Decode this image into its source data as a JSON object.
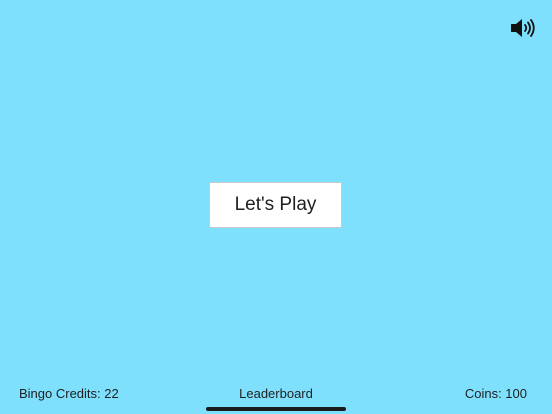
{
  "screen": {
    "background_color": "#7fe0fd"
  },
  "sound_toggle": {
    "icon": "speaker-on-icon"
  },
  "main": {
    "play_button_label": "Let's Play"
  },
  "footer": {
    "bingo_credits": "Bingo Credits: 22",
    "leaderboard_label": "Leaderboard",
    "coins": "Coins: 100"
  }
}
